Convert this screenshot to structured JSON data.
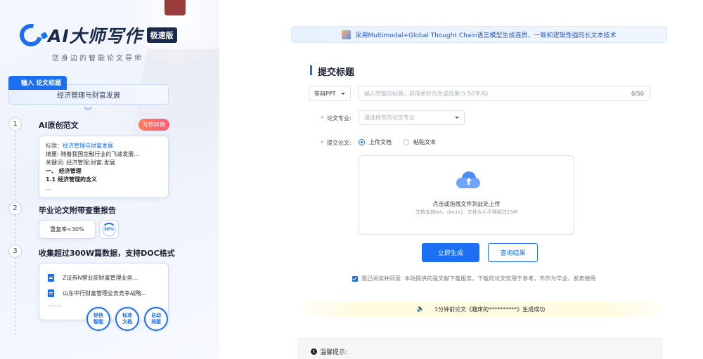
{
  "brand": {
    "name": "AI大师写作",
    "badge": "极速版",
    "slogan": "您身边的智能论文导师"
  },
  "left": {
    "step0": {
      "tag": "输入 论文标题",
      "title_value": "经济管理与财富发展"
    },
    "steps": [
      {
        "num": "1",
        "title": "AI原创范文",
        "badge": "写作样例",
        "sample": {
          "title_key": "标题：",
          "title_val": "经济管理与财富发展",
          "abstract": "摘要: 随着我国金融行业的飞速发展...",
          "keywords": "关键词: 经济管理;财富;发展",
          "h1": "一、 经济管理",
          "h2": "1.1 经济管理的含义",
          "more": "..."
        }
      },
      {
        "num": "2",
        "title": "毕业论文附带查重报告",
        "dup_rate": "重复率<30%",
        "ring_label": "30%"
      },
      {
        "num": "3",
        "title": "收集超过300W篇数据，支持DOC格式",
        "docs": [
          "Z证券N营业部财富管理业务...",
          "山东中行财富管理业务竞争战略..."
        ],
        "more": "... ..."
      }
    ],
    "features": [
      "轻快\n智能",
      "标准\n文档",
      "自动\n排版"
    ]
  },
  "main": {
    "banner": "采用Multimodal+Global Thought Chain语言模型生成连贯、一致和逻辑性强的长文本技术",
    "section_title": "提交标题",
    "type_select": "答辩PPT",
    "title_placeholder": "输入完整的标题，获得更好的生成效果(5-50字内)",
    "title_counter": "0/50",
    "major_label": "论文专业:",
    "major_placeholder": "请选择您的论文专业",
    "submit_label": "提交论文:",
    "radio_upload": "上传文档",
    "radio_paste": "粘贴文本",
    "upload_main": "点击或拖拽文件到此处上传",
    "upload_sub": "文档支持txt、doc(x)、文件大小不得超过15M",
    "generate_btn": "立即生成",
    "query_btn": "查询结果",
    "agree_text": "我已阅读并同意: 本站提供的是文献下载服务，下载的论文仅用于参考，不作为毕业、发表使用",
    "notice": "1分钟前论文《趣床的**********》生成成功",
    "tip_title": "温馨提示:"
  },
  "colors": {
    "accent": "#1c6ef2",
    "badge": "#ff6a6a",
    "notice_bg": "#fffbe0"
  }
}
